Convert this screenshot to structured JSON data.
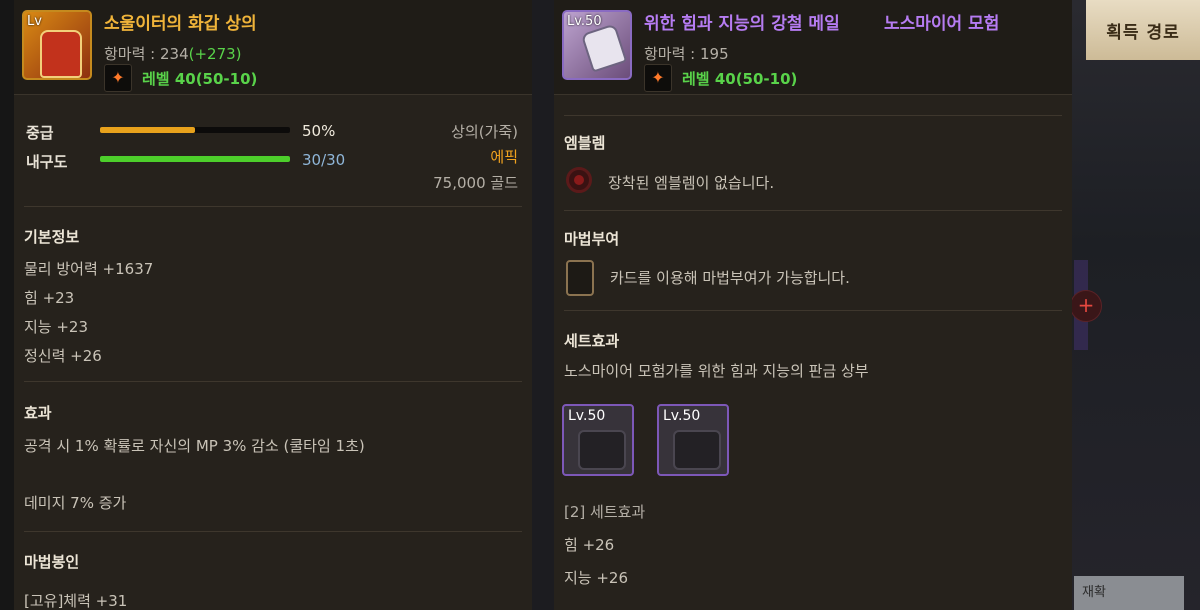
{
  "left_item": {
    "name": "소울이터의 화갑 상의",
    "icon_level_text": "Lv",
    "defense_power_label": "항마력 : 234",
    "defense_power_bonus": "(+273)",
    "level_text": "레벨 40(50-10)",
    "quality_label": "중급",
    "quality_value": "50%",
    "quality_fraction": 0.5,
    "durability_label": "내구도",
    "durability_value": "30/30",
    "durability_fraction": 1.0,
    "slot_type": "상의(가죽)",
    "rarity": "에픽",
    "price": "75,000 골드",
    "basic_info_title": "기본정보",
    "basic_stats": [
      "물리 방어력 +1637",
      "힘 +23",
      "지능 +23",
      "정신력 +26"
    ],
    "effect_title": "효과",
    "effects": [
      "공격 시 1% 확률로 자신의 MP 3% 감소 (쿨타임 1초)",
      "데미지 7% 증가"
    ],
    "seal_title": "마법봉인",
    "seal_stats": [
      "[고유]체력 +31"
    ]
  },
  "right_item": {
    "name": "위한 힘과 지능의 강철 메일",
    "name_suffix": "노스마이어 모험",
    "icon_level_text": "Lv.50",
    "defense_power_label": "항마력 : 195",
    "level_text": "레벨 40(50-10)",
    "emblem_title": "엠블렘",
    "emblem_text": "장착된 엠블렘이 없습니다.",
    "enchant_title": "마법부여",
    "enchant_text": "카드를 이용해 마법부여가 가능합니다.",
    "set_title": "세트효과",
    "set_name": "노스마이어 모험가를 위한 힘과 지능의 판금 상부",
    "set_items": [
      {
        "level": "Lv.50"
      },
      {
        "level": "Lv.50"
      }
    ],
    "set_bonus_title": "[2] 세트효과",
    "set_bonus_stats": [
      "힘 +26",
      "지능 +26"
    ]
  },
  "side": {
    "acquire_button": "획득 경로",
    "plus_icon": "+",
    "bottom_tag": "재확"
  },
  "colors": {
    "gold_title": "#f0b43a",
    "purple_title": "#b67cf2",
    "green_bonus": "#59d34a",
    "quality_bar": "#e8a21c",
    "durability_bar": "#4dcf2b",
    "epic_orange": "#f0a21e"
  },
  "icons": {
    "level_badge": "flame-icon",
    "emblem": "emblem-slot-icon",
    "enchant": "card-slot-icon"
  }
}
